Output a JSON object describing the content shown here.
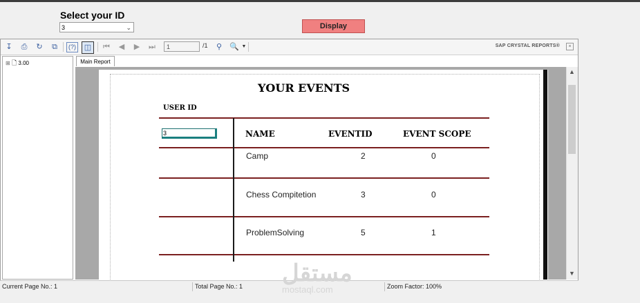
{
  "form": {
    "select_label": "Select your ID",
    "selected_id": "3",
    "display_button": "Display"
  },
  "viewer": {
    "page_input": "1",
    "page_total": "/1",
    "brand": "SAP CRYSTAL REPORTS®",
    "tree_node": "3.00",
    "tab_label": "Main Report"
  },
  "report": {
    "title": "YOUR EVENTS",
    "user_id_label": "USER ID",
    "user_id_value": "3",
    "headers": [
      "NAME",
      "EVENTID",
      "EVENT SCOPE"
    ],
    "rows": [
      {
        "name": "Camp",
        "eventid": "2",
        "scope": "0"
      },
      {
        "name": "Chess Compitetion",
        "eventid": "3",
        "scope": "0"
      },
      {
        "name": "ProblemSolving",
        "eventid": "5",
        "scope": "1"
      }
    ]
  },
  "status": {
    "current_page": "Current Page No.: 1",
    "total_page": "Total Page No.: 1",
    "zoom": "Zoom Factor: 100%"
  },
  "watermark": {
    "main": "مستقل",
    "sub": "mostaql.com"
  },
  "colors": {
    "display_button": "#f08080",
    "table_rule": "#7a1f1f",
    "user_id_box": "#1a7f7f"
  }
}
